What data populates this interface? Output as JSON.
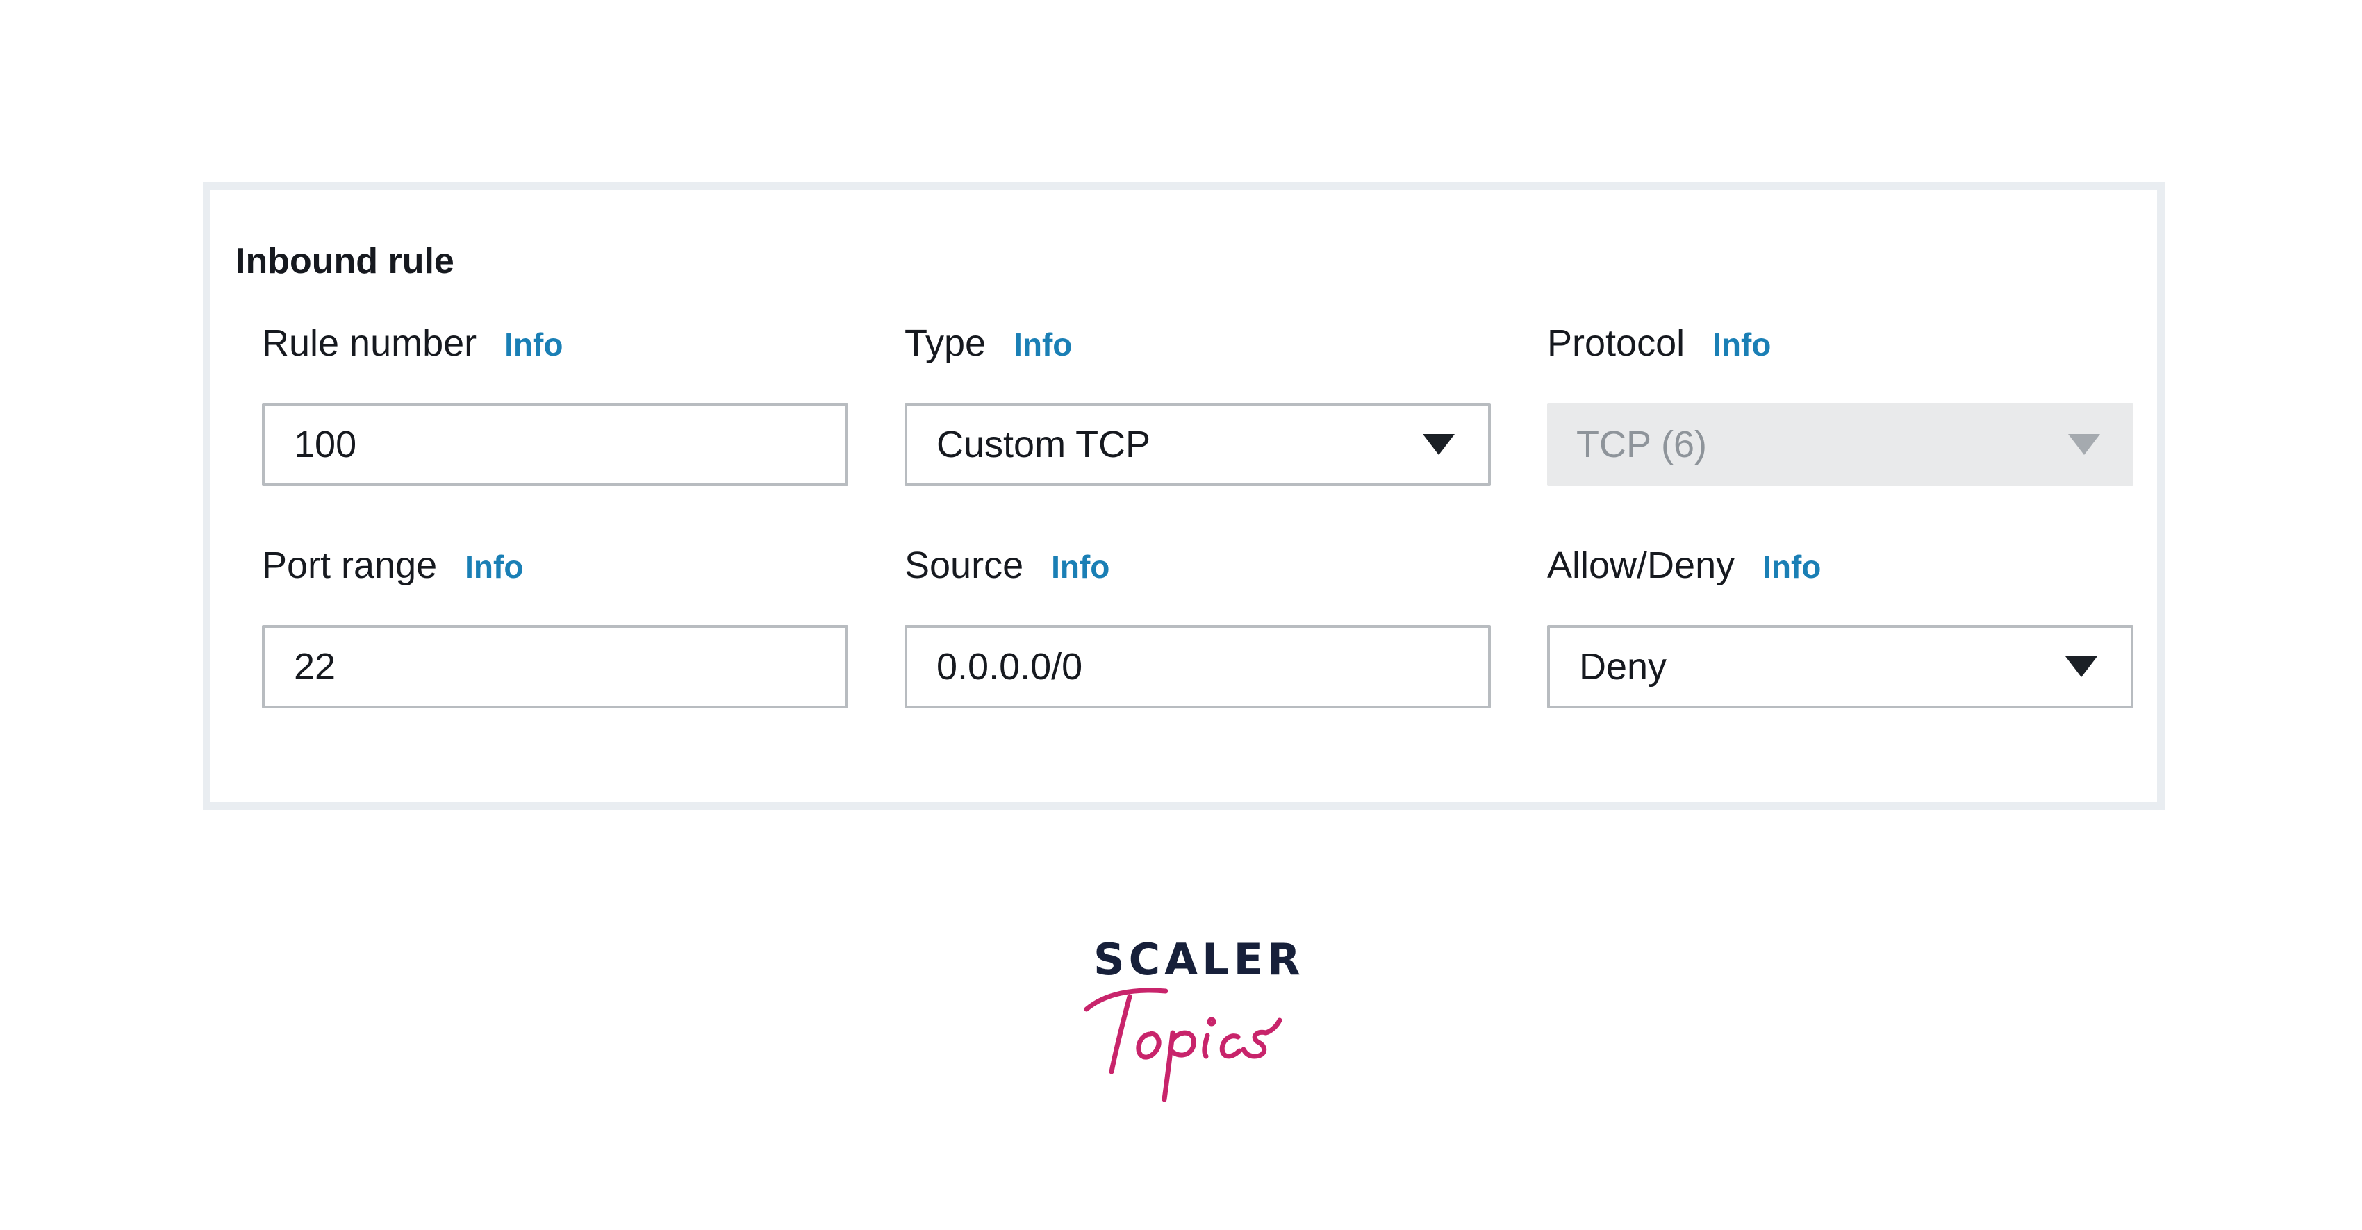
{
  "panel": {
    "title": "Inbound rule"
  },
  "fields": {
    "rule_number": {
      "label": "Rule number",
      "info": "Info",
      "value": "100"
    },
    "type": {
      "label": "Type",
      "info": "Info",
      "value": "Custom TCP"
    },
    "protocol": {
      "label": "Protocol",
      "info": "Info",
      "value": "TCP (6)",
      "disabled": true
    },
    "port_range": {
      "label": "Port range",
      "info": "Info",
      "value": "22"
    },
    "source": {
      "label": "Source",
      "info": "Info",
      "value": "0.0.0.0/0"
    },
    "allow_deny": {
      "label": "Allow/Deny",
      "info": "Info",
      "value": "Deny"
    }
  },
  "logo": {
    "word": "SCALER",
    "script": "Topics"
  },
  "colors": {
    "info_link": "#1a7fb5",
    "panel_border": "#e9edf1",
    "input_border": "#b8bcc0",
    "disabled_bg": "#e9eaeb",
    "logo_navy": "#17203a",
    "logo_pink": "#c8246b"
  },
  "icons": {
    "dropdown_caret": "caret-down-icon"
  }
}
